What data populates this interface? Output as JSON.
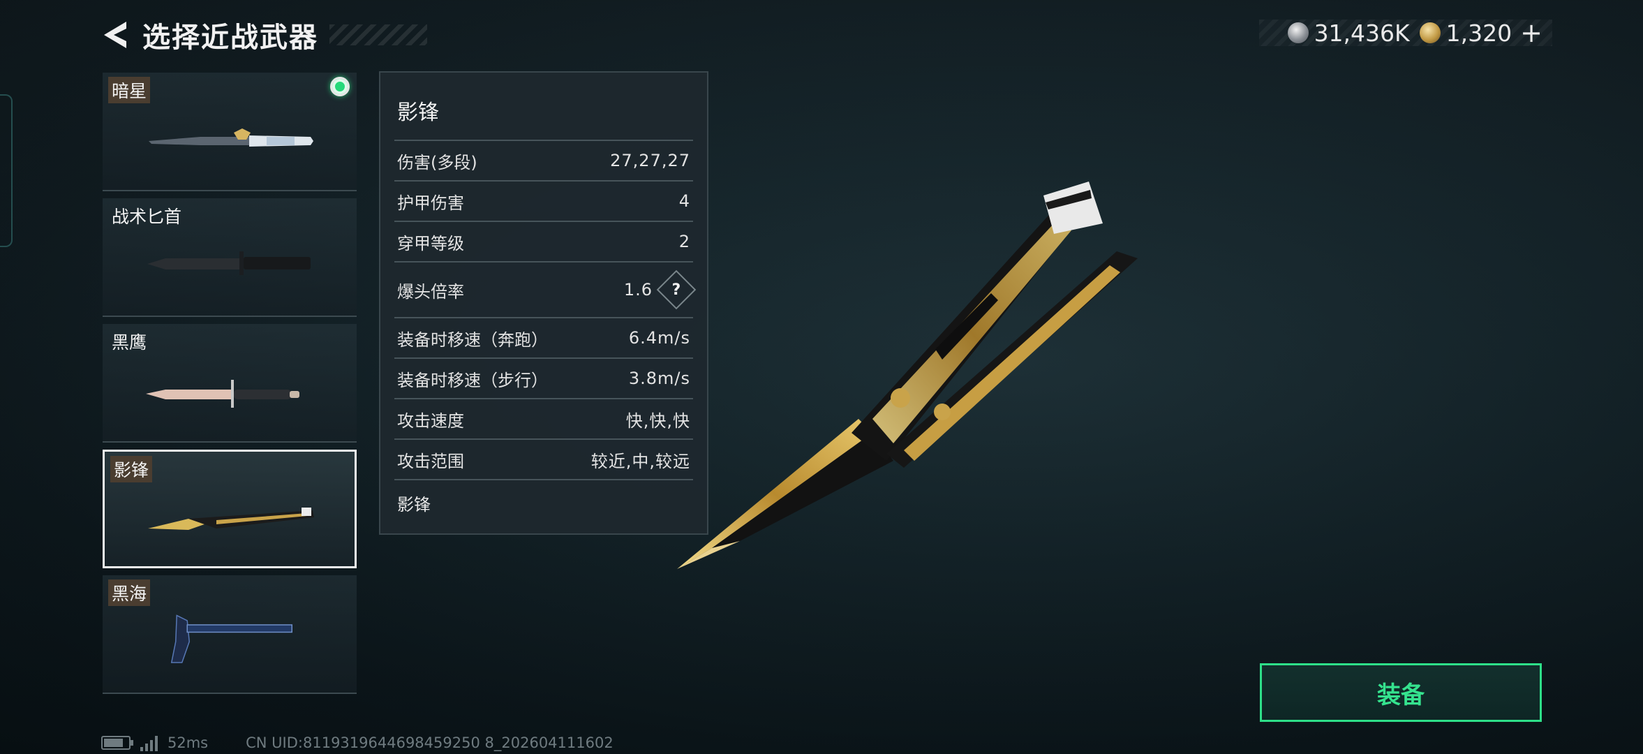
{
  "header": {
    "title": "选择近战武器"
  },
  "currency": [
    {
      "icon": "silver-coin-icon",
      "value": "31,436K"
    },
    {
      "icon": "gold-coin-icon",
      "value": "1,320"
    }
  ],
  "weapons": [
    {
      "name": "暗星",
      "equipped": true,
      "selected": false
    },
    {
      "name": "战术匕首",
      "equipped": false,
      "selected": false
    },
    {
      "name": "黑鹰",
      "equipped": false,
      "selected": false
    },
    {
      "name": "影锋",
      "equipped": false,
      "selected": true
    },
    {
      "name": "黑海",
      "equipped": false,
      "selected": false
    }
  ],
  "stats": {
    "title": "影锋",
    "rows": [
      {
        "label": "伤害(多段)",
        "value": "27,27,27"
      },
      {
        "label": "护甲伤害",
        "value": "4"
      },
      {
        "label": "穿甲等级",
        "value": "2"
      },
      {
        "label": "爆头倍率",
        "value": "1.6",
        "help": "?"
      },
      {
        "label": "装备时移速（奔跑）",
        "value": "6.4m/s"
      },
      {
        "label": "装备时移速（步行）",
        "value": "3.8m/s"
      },
      {
        "label": "攻击速度",
        "value": "快,快,快"
      },
      {
        "label": "攻击范围",
        "value": "较近,中,较远"
      }
    ],
    "footer": "影锋"
  },
  "equip_button": {
    "label": "装备",
    "color": "#35e38e"
  },
  "status_bar": {
    "ping": "52ms",
    "uid": "CN UID:8119319644698459250 8_202604111602"
  }
}
